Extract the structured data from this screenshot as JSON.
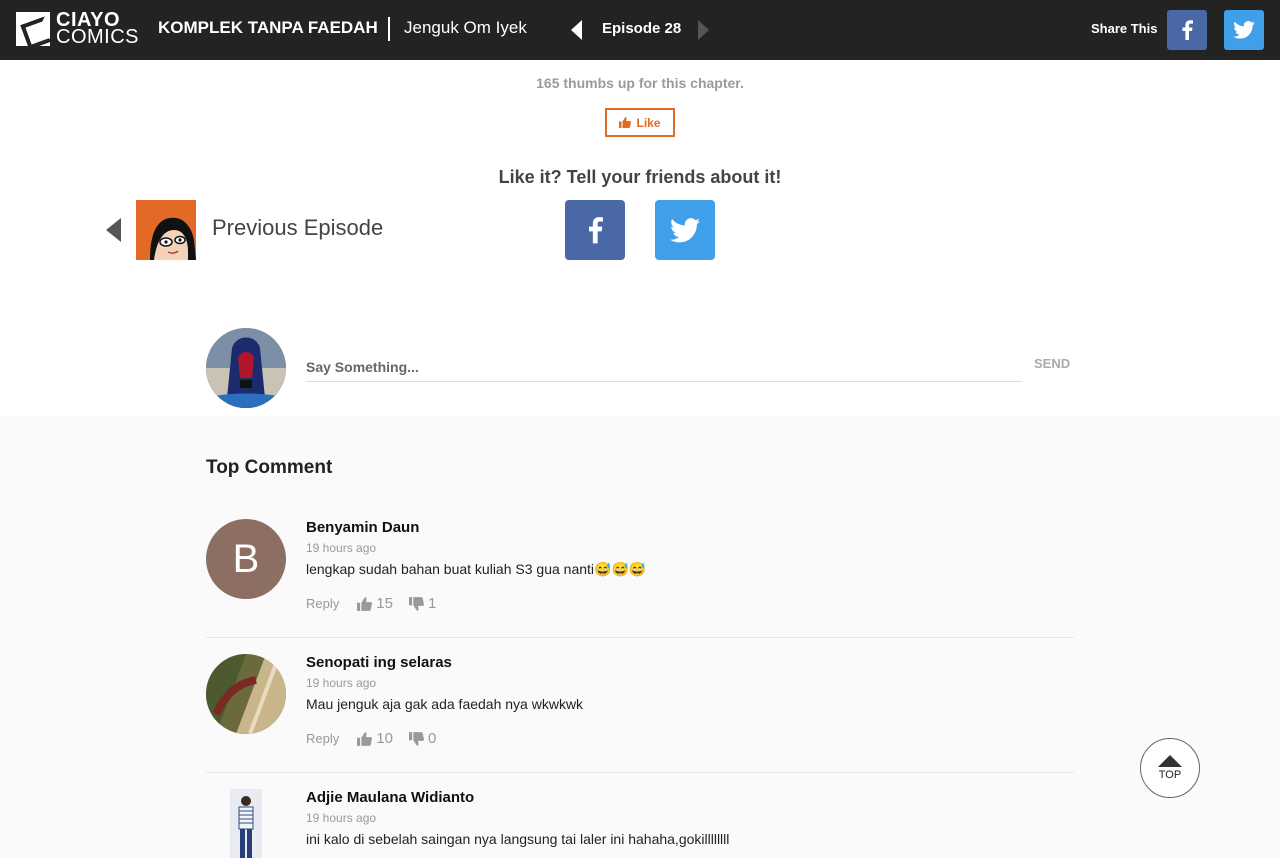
{
  "header": {
    "logo_line1": "CIAYO",
    "logo_line2": "COMICS",
    "series_title": "KOMPLEK TANPA FAEDAH",
    "chapter_title": "Jenguk Om Iyek",
    "episode_label": "Episode 28",
    "share_label": "Share This"
  },
  "chapter": {
    "thumbs_text": "165 thumbs up for this chapter.",
    "like_label": "Like",
    "tell_friends": "Like it? Tell your friends about it!",
    "previous_label": "Previous Episode"
  },
  "comment_box": {
    "placeholder": "Say Something...",
    "send_label": "SEND"
  },
  "top_comment_title": "Top Comment",
  "comments": [
    {
      "name": "Benyamin Daun",
      "time": "19 hours ago",
      "text": "lengkap sudah bahan buat kuliah S3 gua nanti😅😅😅",
      "reply": "Reply",
      "up": "15",
      "down": "1",
      "avatar_letter": "B"
    },
    {
      "name": "Senopati ing selaras",
      "time": "19 hours ago",
      "text": "Mau jenguk aja gak ada faedah nya wkwkwk",
      "reply": "Reply",
      "up": "10",
      "down": "0"
    },
    {
      "name": "Adjie Maulana Widianto",
      "time": "19 hours ago",
      "text": "ini kalo di sebelah saingan nya langsung tai laler ini hahaha,gokillllllll"
    }
  ],
  "top_button_label": "TOP",
  "colors": {
    "header_bg": "#232323",
    "facebook": "#4a67a6",
    "twitter": "#3fa0e9",
    "like_accent": "#e06a27",
    "avatar_b": "#8d6e63"
  }
}
